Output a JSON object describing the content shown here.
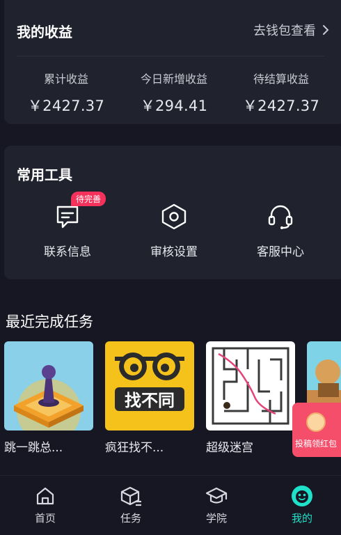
{
  "earnings": {
    "title": "我的收益",
    "wallet_link": "去钱包查看",
    "stats": [
      {
        "label": "累计收益",
        "value": "￥2427.37"
      },
      {
        "label": "今日新增收益",
        "value": "￥294.41"
      },
      {
        "label": "待结算收益",
        "value": "￥2427.37"
      }
    ]
  },
  "tools": {
    "title": "常用工具",
    "items": [
      {
        "label": "联系信息",
        "icon": "contact-info-icon",
        "badge": "待完善"
      },
      {
        "label": "审核设置",
        "icon": "hexagon-settings-icon"
      },
      {
        "label": "客服中心",
        "icon": "headset-icon"
      }
    ]
  },
  "recent_tasks": {
    "title": "最近完成任务",
    "items": [
      {
        "name": "跳一跳总..."
      },
      {
        "name": "疯狂找不...",
        "thumb_text": "找不同"
      },
      {
        "name": "超级迷宫"
      },
      {
        "name": ""
      }
    ]
  },
  "red_packet": {
    "label": "投稿领红包"
  },
  "bottom_nav": {
    "items": [
      {
        "label": "首页",
        "icon": "home-icon",
        "active": false
      },
      {
        "label": "任务",
        "icon": "task-box-icon",
        "active": false
      },
      {
        "label": "学院",
        "icon": "graduation-cap-icon",
        "active": false
      },
      {
        "label": "我的",
        "icon": "profile-face-icon",
        "active": true
      }
    ]
  },
  "colors": {
    "background": "#161722",
    "card": "#20222e",
    "accent": "#1fe0c8",
    "badge": "#f5325c"
  }
}
